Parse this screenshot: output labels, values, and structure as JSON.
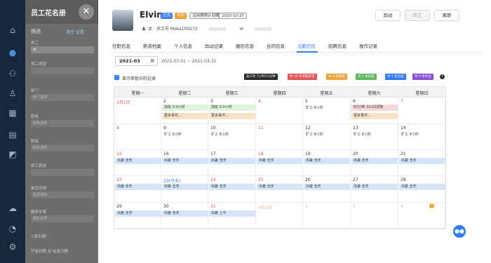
{
  "list_panel": {
    "title": "员工花名册",
    "close_icon": "close-icon",
    "filter_title": "筛选",
    "filter_links": "清空 设置",
    "search_label": "员工",
    "search_value": "el",
    "fields": [
      {
        "label": "员工类型",
        "placeholder": ""
      },
      {
        "label": "部门",
        "placeholder": "部门选择"
      },
      {
        "label": "职务",
        "placeholder": "职务选择"
      },
      {
        "label": "职级",
        "placeholder": "职级选择"
      },
      {
        "label": "员工状态",
        "placeholder": ""
      },
      {
        "label": "是否试用",
        "placeholder": "是否试用"
      },
      {
        "label": "服务年限",
        "placeholder": "服务年限"
      },
      {
        "label": "入职日期",
        "placeholder": ""
      }
    ],
    "bottom_text": "开始日期 至 结束日期"
  },
  "profile": {
    "name": "Elvin",
    "tags": [
      "正式",
      "试用",
      "试用期预计到期",
      "2020-10-27"
    ],
    "gender_id": "女 · 员工号 Moka100272",
    "buttons": {
      "b1": "异动",
      "b2": "转正",
      "b3": "离职"
    }
  },
  "tabs": [
    "任职信息",
    "薪资档案",
    "个人信息",
    "异动记录",
    "履历信息",
    "合同信息",
    "出勤日历",
    "招聘信息",
    "操作记录"
  ],
  "active_tab": "出勤日历",
  "month_select": {
    "value": "2021-03",
    "range": "2021-03-01 ~ 2021-03-31"
  },
  "show_approval": "显示审批中的记录",
  "legends": [
    {
      "label": "总工时 7小时51分钟",
      "color": "#2b2b2b"
    },
    {
      "label": "共 10 条考勤异常",
      "color": "#e05656"
    },
    {
      "label": "共 0 条请假",
      "color": "#f0a13a"
    },
    {
      "label": "共 2 条加班",
      "color": "#5cb85c"
    },
    {
      "label": "共 1 条出差",
      "color": "#2f7cf6"
    },
    {
      "label": "共 0 条外出",
      "color": "#8a4fd6"
    }
  ],
  "weekdays": [
    "星期一",
    "星期二",
    "星期三",
    "星期四",
    "星期五",
    "星期六",
    "星期日"
  ],
  "calendar": {
    "w1": [
      "3月1日",
      "2",
      "3",
      "4",
      "5",
      "6",
      "7"
    ],
    "w2": [
      "8",
      "9",
      "10",
      "11",
      "12",
      "13",
      "14"
    ],
    "w3": [
      "15",
      "16",
      "17",
      "18",
      "19",
      "20",
      "21"
    ],
    "w4": [
      "22",
      "23(今天)",
      "24",
      "25",
      "26",
      "27",
      "28"
    ],
    "w5": [
      "29",
      "30",
      "31",
      "4月1日",
      "2",
      "3",
      "4"
    ],
    "overtime": "加班 0.0小时",
    "more": "更多事件...",
    "absent": "旷工 8小时",
    "late": "62分钟 10:02迟到",
    "full": "出差 全天",
    "morning": "出差 上午"
  },
  "icons": {
    "chat": "chat-icon",
    "info": "info-icon",
    "corner": "corner-badge-icon"
  }
}
